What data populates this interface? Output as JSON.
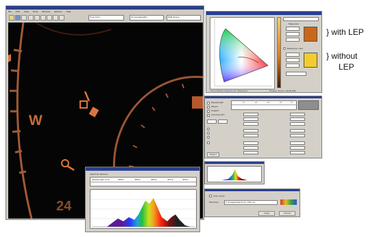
{
  "annotations": {
    "with_lep": "} with LEP",
    "without_lep_line1": "} without",
    "without_lep_line2": "LEP"
  },
  "main_window": {
    "menus": [
      "File",
      "Edit",
      "View",
      "Tools",
      "Window",
      "Options",
      "Help"
    ],
    "toolbar_field_1": "True Color",
    "toolbar_field_2": "All wavelengths",
    "toolbar_field_3": "RGB Space",
    "dial_labels": {
      "w": "W",
      "n24": "24"
    }
  },
  "chromaticity_window": {
    "legend_group_top": "Measured",
    "legend_group_bottom": "Reference color",
    "swatch_with_lep": "#c8671a",
    "swatch_without_lep": "#f2cc2e",
    "footer_left": "Chromaticity diagram (2° Observer)",
    "footer_right": "Display device: sRGB D65"
  },
  "report_window": {
    "export_label": "Export",
    "options": [
      "Wavelength",
      "Object",
      "Subject",
      "Chromax 5th"
    ],
    "table_headers": [
      "",
      "L*",
      "a*",
      "b*",
      "C*",
      "h°"
    ]
  },
  "spectrum_window": {
    "title": "Spectral radiance",
    "column_headers": [
      "Wavelength (nm)",
      "380.0",
      "390.0",
      "400.0",
      "410.0",
      "420.0"
    ]
  },
  "export_dialog": {
    "checkbox_label": "Auto-name",
    "path_label": "Filename",
    "path_value": "C:\\Images\\spectrum_001.csv",
    "ok_label": "Apply",
    "cancel_label": "Cancel"
  },
  "colors": {
    "hud_orange": "#d8773c",
    "titlebar": "#2a3f8f",
    "window_face": "#d4d0c8"
  }
}
